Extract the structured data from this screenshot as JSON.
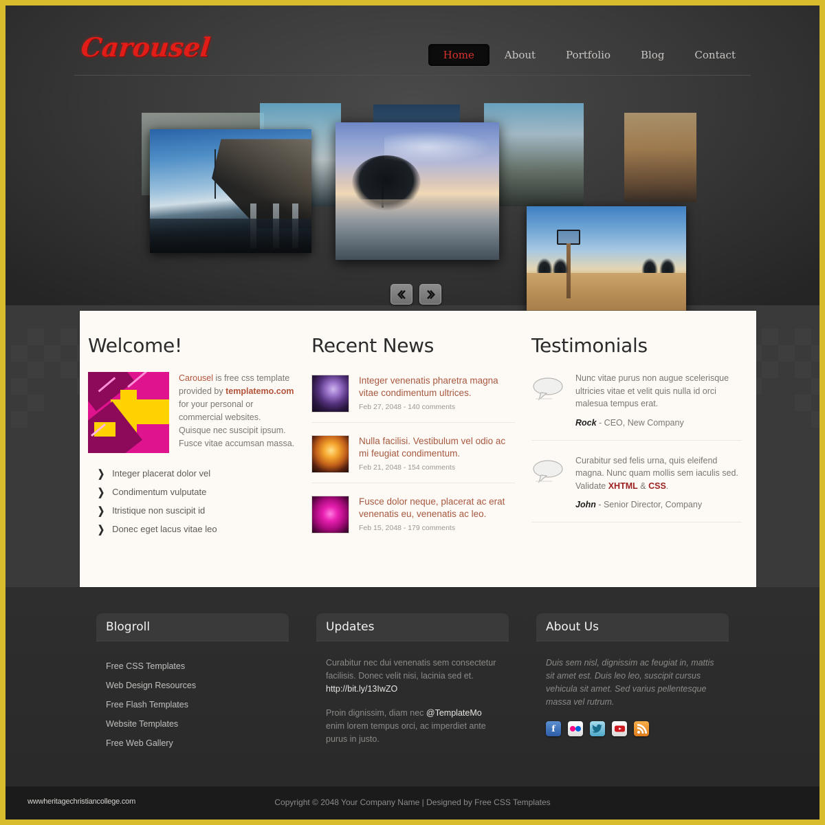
{
  "site": {
    "logo": "Carousel",
    "accent_red": "#e21d18",
    "border_gold": "#d8bc2d"
  },
  "nav": {
    "items": [
      {
        "label": "Home",
        "active": true
      },
      {
        "label": "About",
        "active": false
      },
      {
        "label": "Portfolio",
        "active": false
      },
      {
        "label": "Blog",
        "active": false
      },
      {
        "label": "Contact",
        "active": false
      }
    ]
  },
  "carousel": {
    "prev_label": "❮",
    "next_label": "❯",
    "slides": [
      {
        "name": "pier-at-dusk"
      },
      {
        "name": "tree-silhouette-sunset"
      },
      {
        "name": "beach-basketball-hoop"
      }
    ]
  },
  "welcome": {
    "title": "Welcome!",
    "image_alt": "abstract-arrows-graphic",
    "intro_1": "Carousel",
    "intro_2": " is free css template provided by ",
    "intro_3": "templatemo.com",
    "intro_4": " for your personal or commercial websites. Quisque nec suscipit ipsum. Fusce vitae accumsan massa.",
    "bullets": [
      "Integer placerat dolor vel",
      "Condimentum vulputate",
      "Itristique non suscipit id",
      "Donec eget lacus vitae leo"
    ]
  },
  "news": {
    "title": "Recent News",
    "items": [
      {
        "title": "Integer venenatis pharetra magna vitae condimentum  ultrices.",
        "meta": "Feb 27, 2048 - 140 comments",
        "thumb": "bokeh-purple"
      },
      {
        "title": "Nulla facilisi. Vestibulum vel odio ac mi feugiat condimentum.",
        "meta": "Feb 21, 2048 - 154 comments",
        "thumb": "bokeh-orange"
      },
      {
        "title": "Fusce dolor neque, placerat ac erat venenatis eu, venenatis ac leo.",
        "meta": "Feb 15, 2048 - 179 comments",
        "thumb": "bokeh-pink"
      }
    ]
  },
  "testimonials": {
    "title": "Testimonials",
    "items": [
      {
        "quote": "Nunc vitae purus non augue scelerisque ultricies vitae et velit quis nulla id orci malesua tempus erat.",
        "author": "Rock",
        "role": " - CEO, New Company",
        "quote_pre": "",
        "quote_post": ""
      },
      {
        "quote_pre": "Curabitur sed felis urna, quis eleifend magna. Nunc quam mollis sem iaculis sed. Validate ",
        "code_1": "XHTML",
        "quote_mid": " & ",
        "code_2": "CSS",
        "quote_post": ".",
        "author": "John",
        "role": " - Senior Director, Company"
      }
    ]
  },
  "footer": {
    "blogroll": {
      "title": "Blogroll",
      "links": [
        "Free CSS Templates",
        "Web Design Resources",
        "Free Flash Templates",
        "Website Templates",
        "Free Web Gallery"
      ]
    },
    "updates": {
      "title": "Updates",
      "p1_pre": "Curabitur nec dui venenatis sem consectetur facilisis. Donec velit nisi, lacinia sed et. ",
      "p1_link": "http://bit.ly/13IwZO",
      "p2_pre": "Proin dignissim, diam nec ",
      "p2_handle": "@TemplateMo",
      "p2_post": " enim lorem tempus orci, ac imperdiet ante purus in justo."
    },
    "about": {
      "title": "About Us",
      "text": "Duis sem nisl, dignissim ac feugiat in, mattis sit amet est. Duis leo leo, suscipit cursus vehicula sit amet. Sed varius pellentesque massa vel rutrum.",
      "socials": [
        {
          "name": "facebook-icon",
          "glyph": "f"
        },
        {
          "name": "flickr-icon",
          "glyph": ""
        },
        {
          "name": "twitter-icon",
          "glyph": "t"
        },
        {
          "name": "youtube-icon",
          "glyph": ""
        },
        {
          "name": "rss-icon",
          "glyph": ""
        }
      ]
    }
  },
  "bottom": {
    "watermark": "wwwheritagechristiancollege.com",
    "copyright": "Copyright © 2048 Your Company Name | Designed by Free CSS Templates"
  }
}
